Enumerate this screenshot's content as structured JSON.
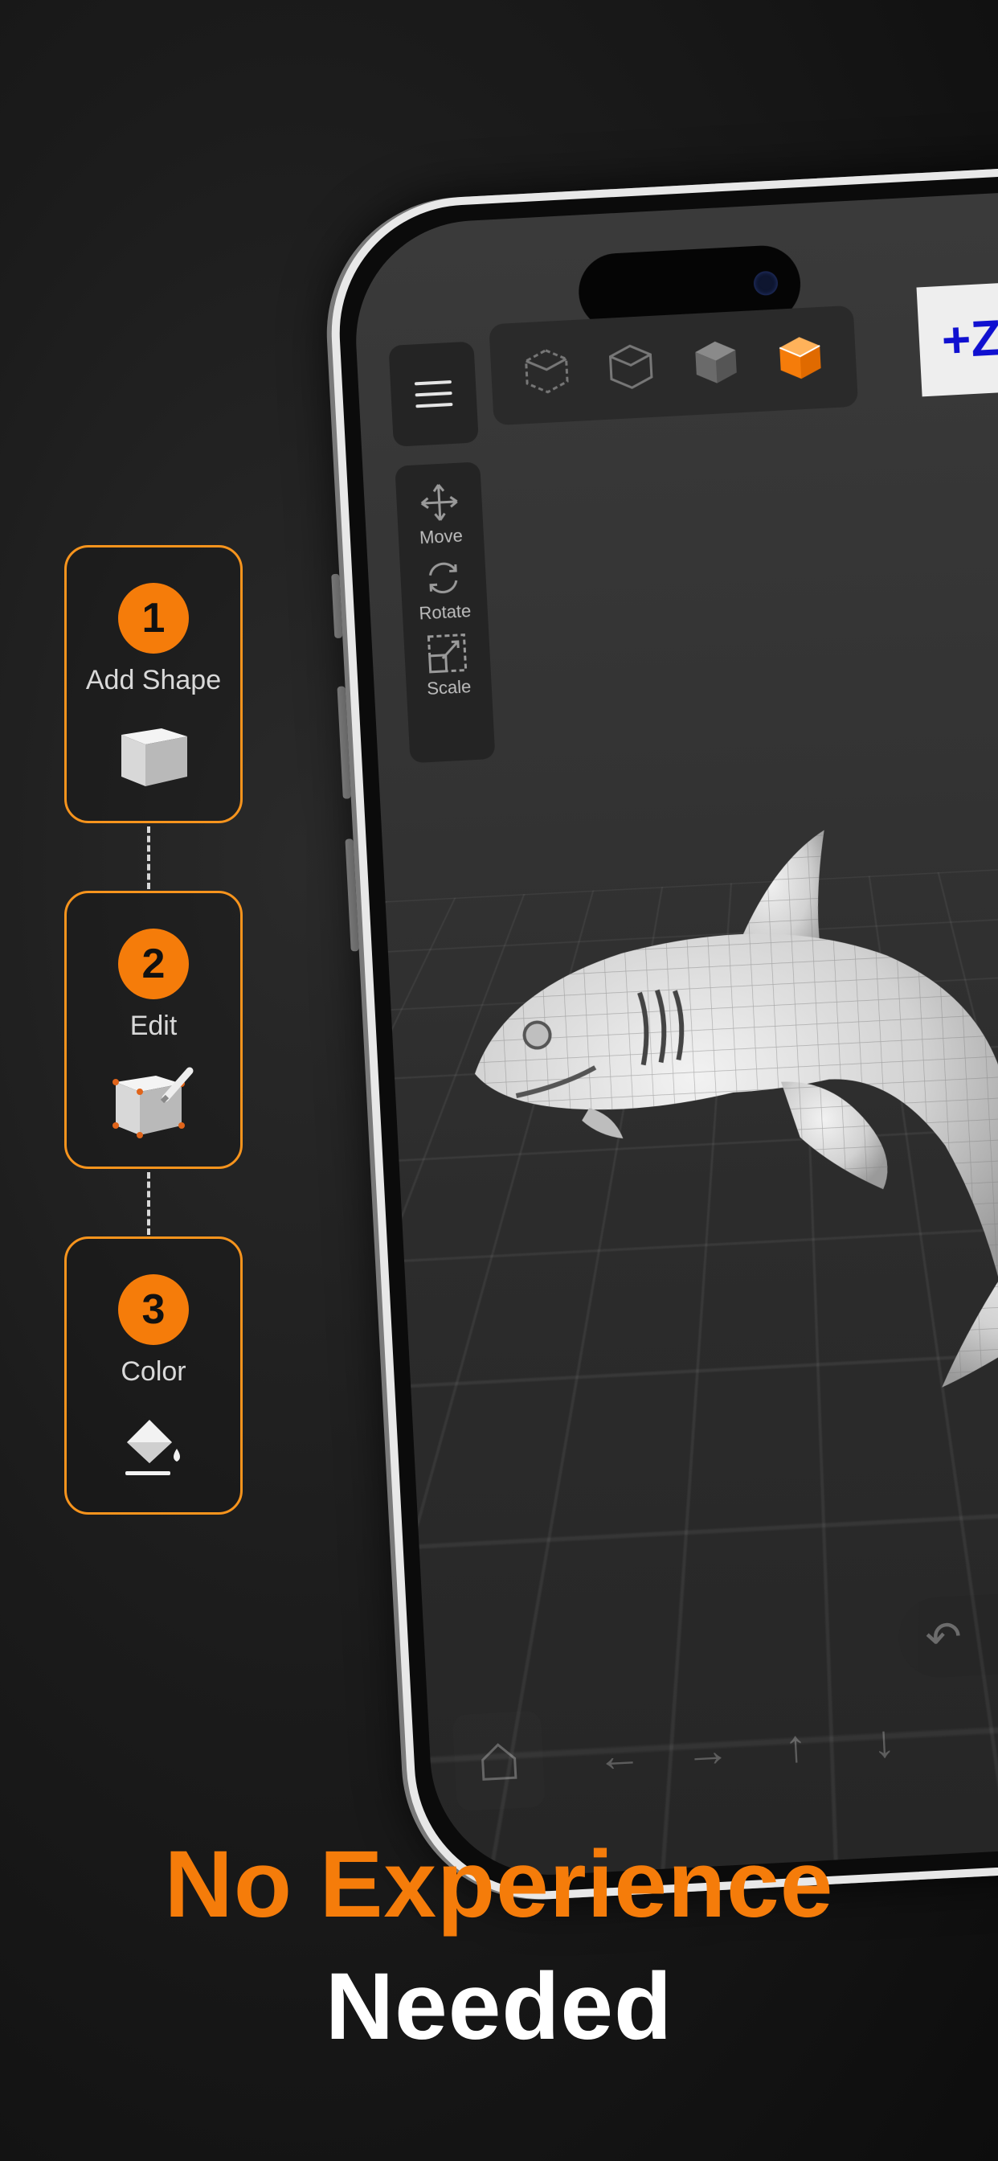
{
  "steps": [
    {
      "number": "1",
      "label": "Add Shape",
      "icon": "cube-icon"
    },
    {
      "number": "2",
      "label": "Edit",
      "icon": "edit-cube-icon"
    },
    {
      "number": "3",
      "label": "Color",
      "icon": "paint-bucket-icon"
    }
  ],
  "app": {
    "axis_label": "+Z",
    "tools": [
      {
        "label": "Move",
        "icon": "move-icon"
      },
      {
        "label": "Rotate",
        "icon": "rotate-icon"
      },
      {
        "label": "Scale",
        "icon": "scale-icon"
      }
    ],
    "view_modes": [
      "wireframe-view-icon",
      "outline-view-icon",
      "solid-view-icon",
      "color-view-icon"
    ],
    "bottom_arrows": [
      "←",
      "→",
      "↑",
      "↓"
    ]
  },
  "headline": {
    "line1": "No Experience",
    "line2": "Needed"
  },
  "colors": {
    "accent": "#f57c0a",
    "background": "#1b1b1b",
    "axis_text": "#1010d0"
  }
}
